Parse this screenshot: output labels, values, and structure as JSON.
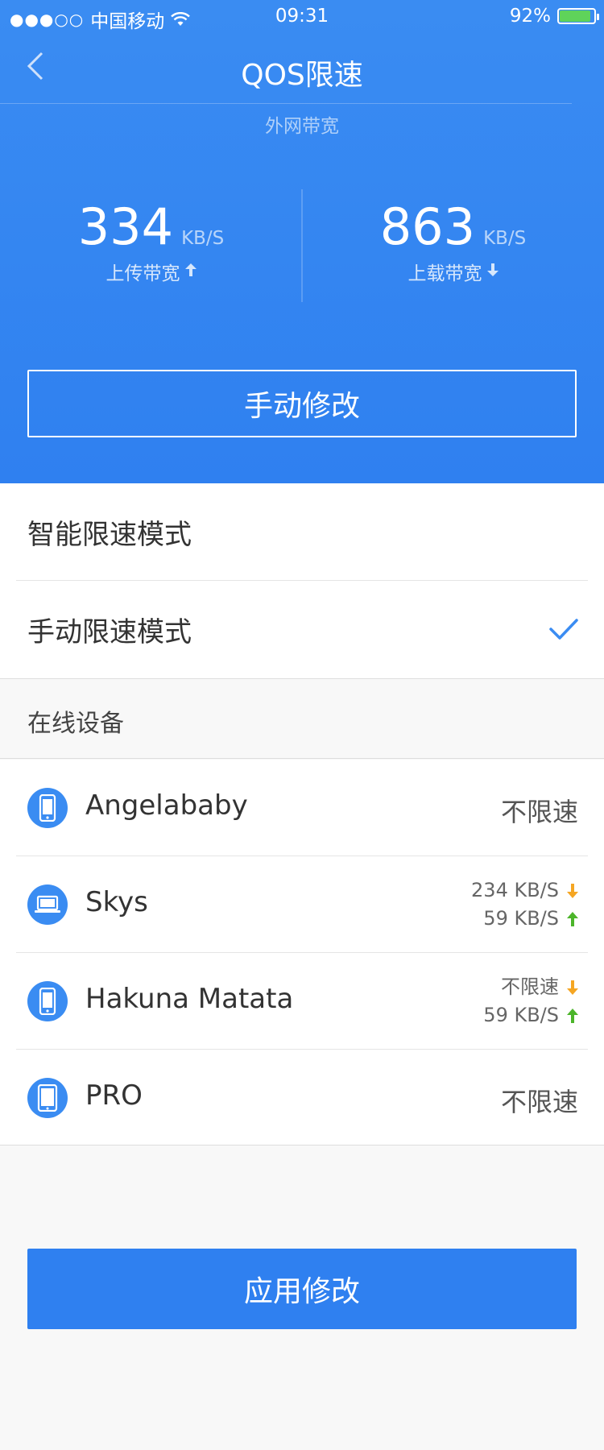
{
  "status_bar": {
    "carrier": "中国移动",
    "time": "09:31",
    "battery": "92%",
    "battery_level": 0.92
  },
  "nav": {
    "title": "QOS限速",
    "subtitle": "外网带宽"
  },
  "bandwidth": {
    "upload": {
      "value": "334",
      "unit": "KB/S",
      "label": "上传带宽"
    },
    "download": {
      "value": "863",
      "unit": "KB/S",
      "label": "上载带宽"
    }
  },
  "manual_edit_label": "手动修改",
  "modes": [
    {
      "label": "智能限速模式",
      "selected": false
    },
    {
      "label": "手动限速模式",
      "selected": true
    }
  ],
  "online_devices_label": "在线设备",
  "devices": [
    {
      "name": "Angelababy",
      "icon": "phone-icon",
      "status": "不限速"
    },
    {
      "name": "Skys",
      "icon": "laptop-icon",
      "down": "234 KB/S",
      "up": "59 KB/S"
    },
    {
      "name": "Hakuna Matata",
      "icon": "phone-icon",
      "down": "不限速",
      "up": "59 KB/S"
    },
    {
      "name": "PRO",
      "icon": "tablet-icon",
      "status": "不限速"
    }
  ],
  "apply_label": "应用修改",
  "colors": {
    "primary": "#2f80f0",
    "down_arrow": "#f5a623",
    "up_arrow": "#4cb52a",
    "battery": "#5fd35a"
  }
}
